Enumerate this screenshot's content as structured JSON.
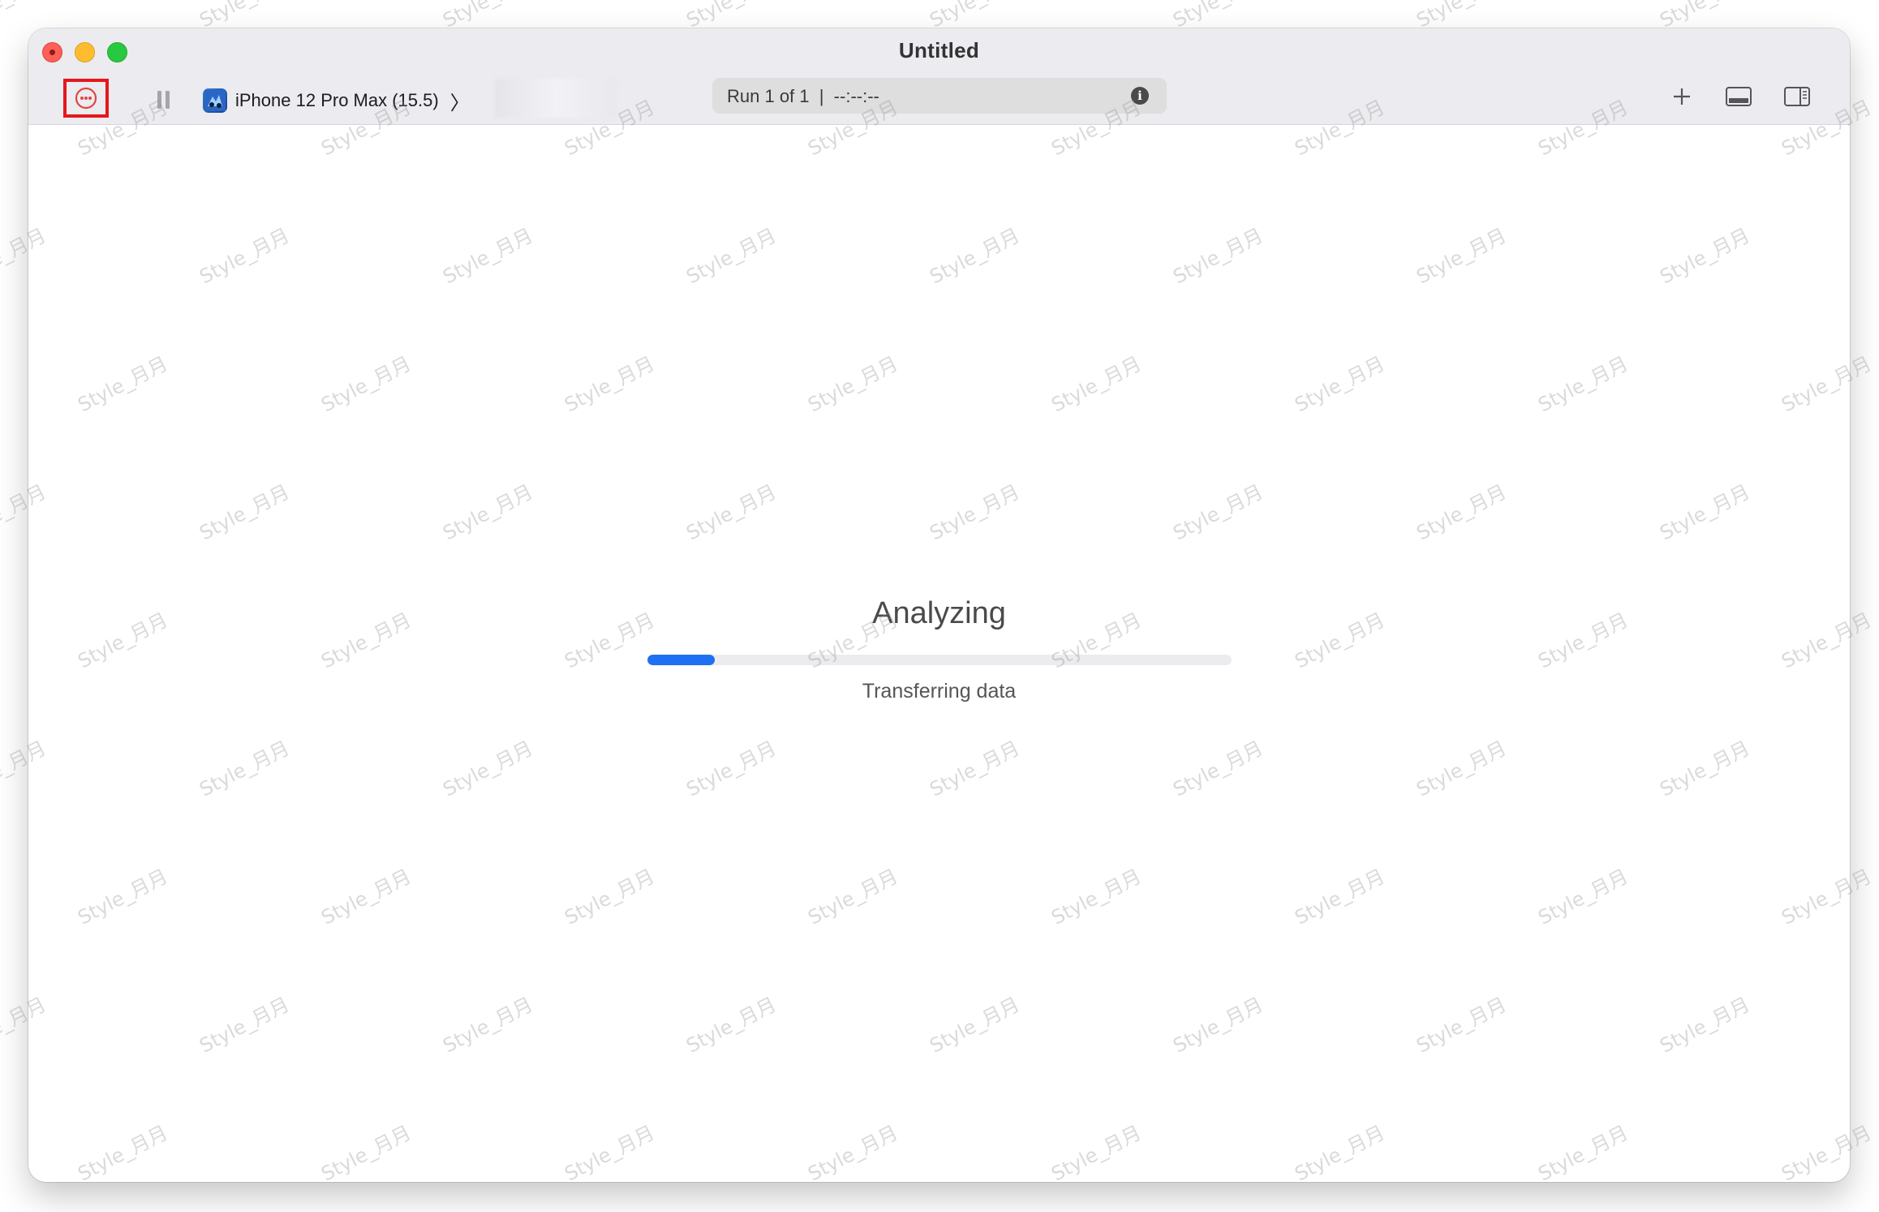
{
  "window": {
    "title": "Untitled"
  },
  "toolbar": {
    "record_icon": "record-stop-icon",
    "pause_icon": "pause-icon",
    "device_label": "iPhone 12 Pro Max (15.5)",
    "chevron": "〉",
    "status_text": "Run 1 of 1  |  --:--:--",
    "info_icon_label": "i",
    "add_icon": "plus-icon",
    "bottom_panel_icon": "bottom-panel-icon",
    "right_panel_icon": "right-panel-icon"
  },
  "main": {
    "heading": "Analyzing",
    "subtext": "Transferring data",
    "progress_fraction": 0.115
  },
  "watermark": {
    "text": "Style_月月"
  },
  "colors": {
    "accent": "#1f6ff2",
    "highlight_border": "#e5171c",
    "record_red": "#e0463f"
  }
}
